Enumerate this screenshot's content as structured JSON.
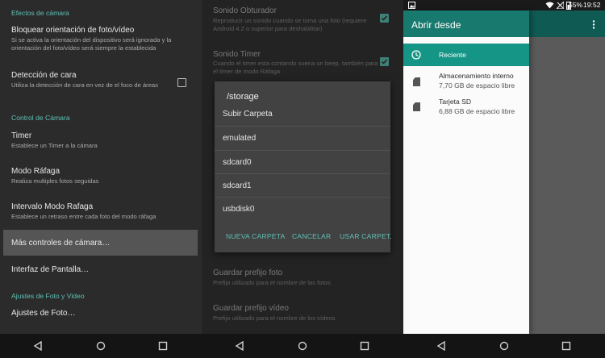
{
  "panel1": {
    "sections": [
      {
        "category": "Efectos de cámara"
      },
      {
        "category": "Control de Cámara"
      },
      {
        "category": "Ajustes de Foto y Video"
      }
    ],
    "prefs": {
      "lock_orientation": {
        "title": "Bloquear orientación de foto/vídeo",
        "summary": "Si se activa la orientación del dispositivo será ignorada y la orientación del foto/vídeo será siempre la establecida"
      },
      "face_detection": {
        "title": "Detección de cara",
        "summary": "Utiliza la detección de cara en vez de el foco de áreas",
        "checked": false
      },
      "timer": {
        "title": "Timer",
        "summary": "Establece un Timer a la cámara"
      },
      "burst_mode": {
        "title": "Modo Ráfaga",
        "summary": "Realiza multiples fotos seguidas"
      },
      "burst_interval": {
        "title": "Intervalo Modo Rafaga",
        "summary": "Establece un retraso entre cada foto del modo ráfaga"
      },
      "more_controls": {
        "title": "Más controles de cámara…",
        "highlighted": true
      },
      "screen_interface": {
        "title": "Interfaz de Pantalla…"
      },
      "photo_settings": {
        "title": "Ajustes de Foto…"
      }
    }
  },
  "panel2": {
    "background_prefs": {
      "shutter_sound": {
        "title": "Sonido Obturador",
        "summary": "Reproducir un sonido cuando se toma una foto (requiere Android 4.2 o superior para deshabilitar)",
        "checked": true
      },
      "timer_sound": {
        "title": "Sonido Timer",
        "summary": "Cuando el timer esta contando suena un beep, también para el timer de modo Ráfaga",
        "checked": true
      },
      "save_photo_prefix": {
        "title": "Guardar prefijo foto",
        "summary": "Prefijo utilizado para el nombre de las fotos"
      },
      "save_video_prefix": {
        "title": "Guardar prefijo vídeo",
        "summary": "Prefijo utilizado para el nombre de los vídeos"
      }
    },
    "dialog": {
      "title": "/storage",
      "items": [
        "Subir Carpeta",
        "emulated",
        "sdcard0",
        "sdcard1",
        "usbdisk0"
      ],
      "buttons": {
        "new_folder": "NUEVA CARPETA",
        "cancel": "CANCELAR",
        "use_folder": "USAR CARPET."
      }
    }
  },
  "panel3": {
    "status_bar": {
      "battery": "55%",
      "time": "19:52"
    },
    "drawer": {
      "title": "Abrir desde",
      "roots": [
        {
          "label": "Reciente",
          "icon": "clock-icon",
          "selected": true
        },
        {
          "label": "Almacenamiento interno",
          "summary": "7,70 GB de espacio libre",
          "icon": "sd-card-icon"
        },
        {
          "label": "Tarjeta SD",
          "summary": "6,88 GB de espacio libre",
          "icon": "sd-card-icon"
        }
      ]
    }
  },
  "colors": {
    "accent_teal": "#5fc0b4",
    "drawer_selected": "#149585",
    "drawer_header": "#18796e"
  },
  "navbar_icons": [
    "back-icon",
    "home-icon",
    "recent-apps-icon"
  ]
}
